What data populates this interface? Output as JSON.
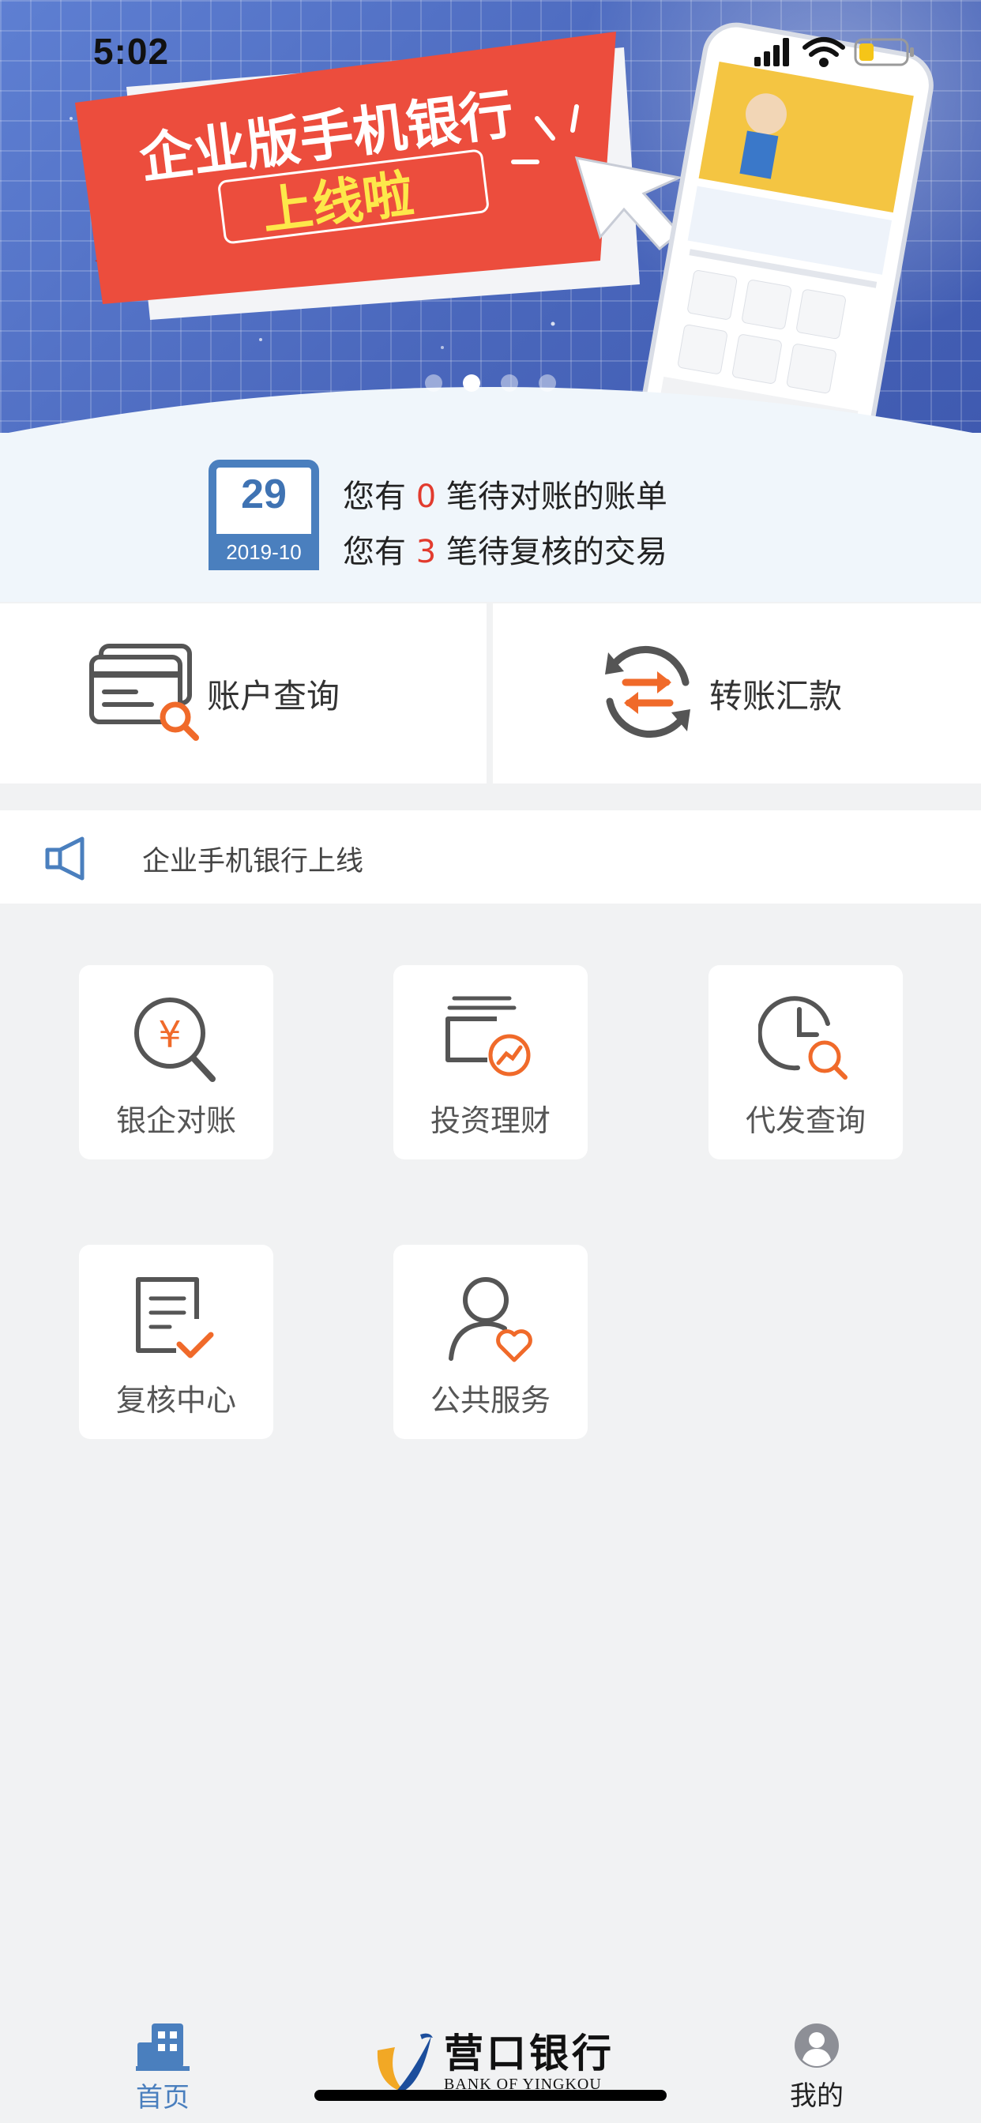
{
  "status_bar": {
    "time": "5:02"
  },
  "banner": {
    "title_line1": "企业版手机银行",
    "title_line2": "上线啦",
    "slide_count": 4,
    "active_slide_index": 1
  },
  "notice": {
    "calendar_day": "29",
    "calendar_month": "2019-10",
    "line1": {
      "prefix": "您有 ",
      "count": "0",
      "suffix": " 笔待对账的账单"
    },
    "line2": {
      "prefix": "您有 ",
      "count": "3",
      "suffix": " 笔待复核的交易"
    }
  },
  "quick_actions": {
    "account_query": "账户查询",
    "transfer": "转账汇款"
  },
  "announcement": {
    "text": "企业手机银行上线"
  },
  "grid": {
    "items": [
      {
        "label": "银企对账",
        "icon": "yen-search-icon"
      },
      {
        "label": "投资理财",
        "icon": "wallet-growth-icon"
      },
      {
        "label": "代发查询",
        "icon": "clock-search-icon"
      },
      {
        "label": "复核中心",
        "icon": "document-check-icon"
      },
      {
        "label": "公共服务",
        "icon": "person-heart-icon"
      }
    ]
  },
  "tabbar": {
    "home": "首页",
    "brand_name": "营口银行",
    "brand_en": "BANK OF YINGKOU",
    "mine": "我的"
  },
  "colors": {
    "accent_blue": "#4a7fbe",
    "accent_orange": "#f06a2a",
    "alert_red": "#e23b2e",
    "banner_red": "#ec4d3d"
  }
}
